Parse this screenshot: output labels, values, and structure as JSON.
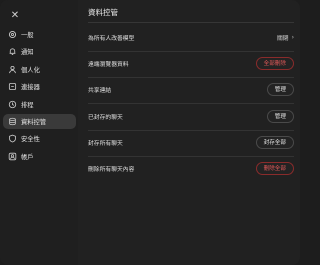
{
  "colors": {
    "danger": "#e35a5a",
    "active_bg": "#3a3a3a",
    "bg": "#212121"
  },
  "sidebar": {
    "close_icon": "close-icon",
    "items": [
      {
        "label": "一般",
        "icon": "gear-icon",
        "active": false
      },
      {
        "label": "通知",
        "icon": "bell-icon",
        "active": false
      },
      {
        "label": "個人化",
        "icon": "person-icon",
        "active": false
      },
      {
        "label": "連接器",
        "icon": "connector-icon",
        "active": false
      },
      {
        "label": "排程",
        "icon": "clock-icon",
        "active": false
      },
      {
        "label": "資料控管",
        "icon": "database-icon",
        "active": true
      },
      {
        "label": "安全性",
        "icon": "shield-icon",
        "active": false
      },
      {
        "label": "帳戶",
        "icon": "account-icon",
        "active": false
      }
    ]
  },
  "main": {
    "title": "資料控管",
    "rows": [
      {
        "label": "為所有人改善模型",
        "action": "關閉",
        "kind": "link"
      },
      {
        "label": "遠端瀏覽器資料",
        "action": "全部刪除",
        "kind": "danger"
      },
      {
        "label": "共享連結",
        "action": "管理",
        "kind": "neutral"
      },
      {
        "label": "已封存的聊天",
        "action": "管理",
        "kind": "neutral"
      },
      {
        "label": "封存所有聊天",
        "action": "封存全部",
        "kind": "neutral"
      },
      {
        "label": "刪除所有聊天內容",
        "action": "刪除全部",
        "kind": "danger"
      }
    ]
  }
}
